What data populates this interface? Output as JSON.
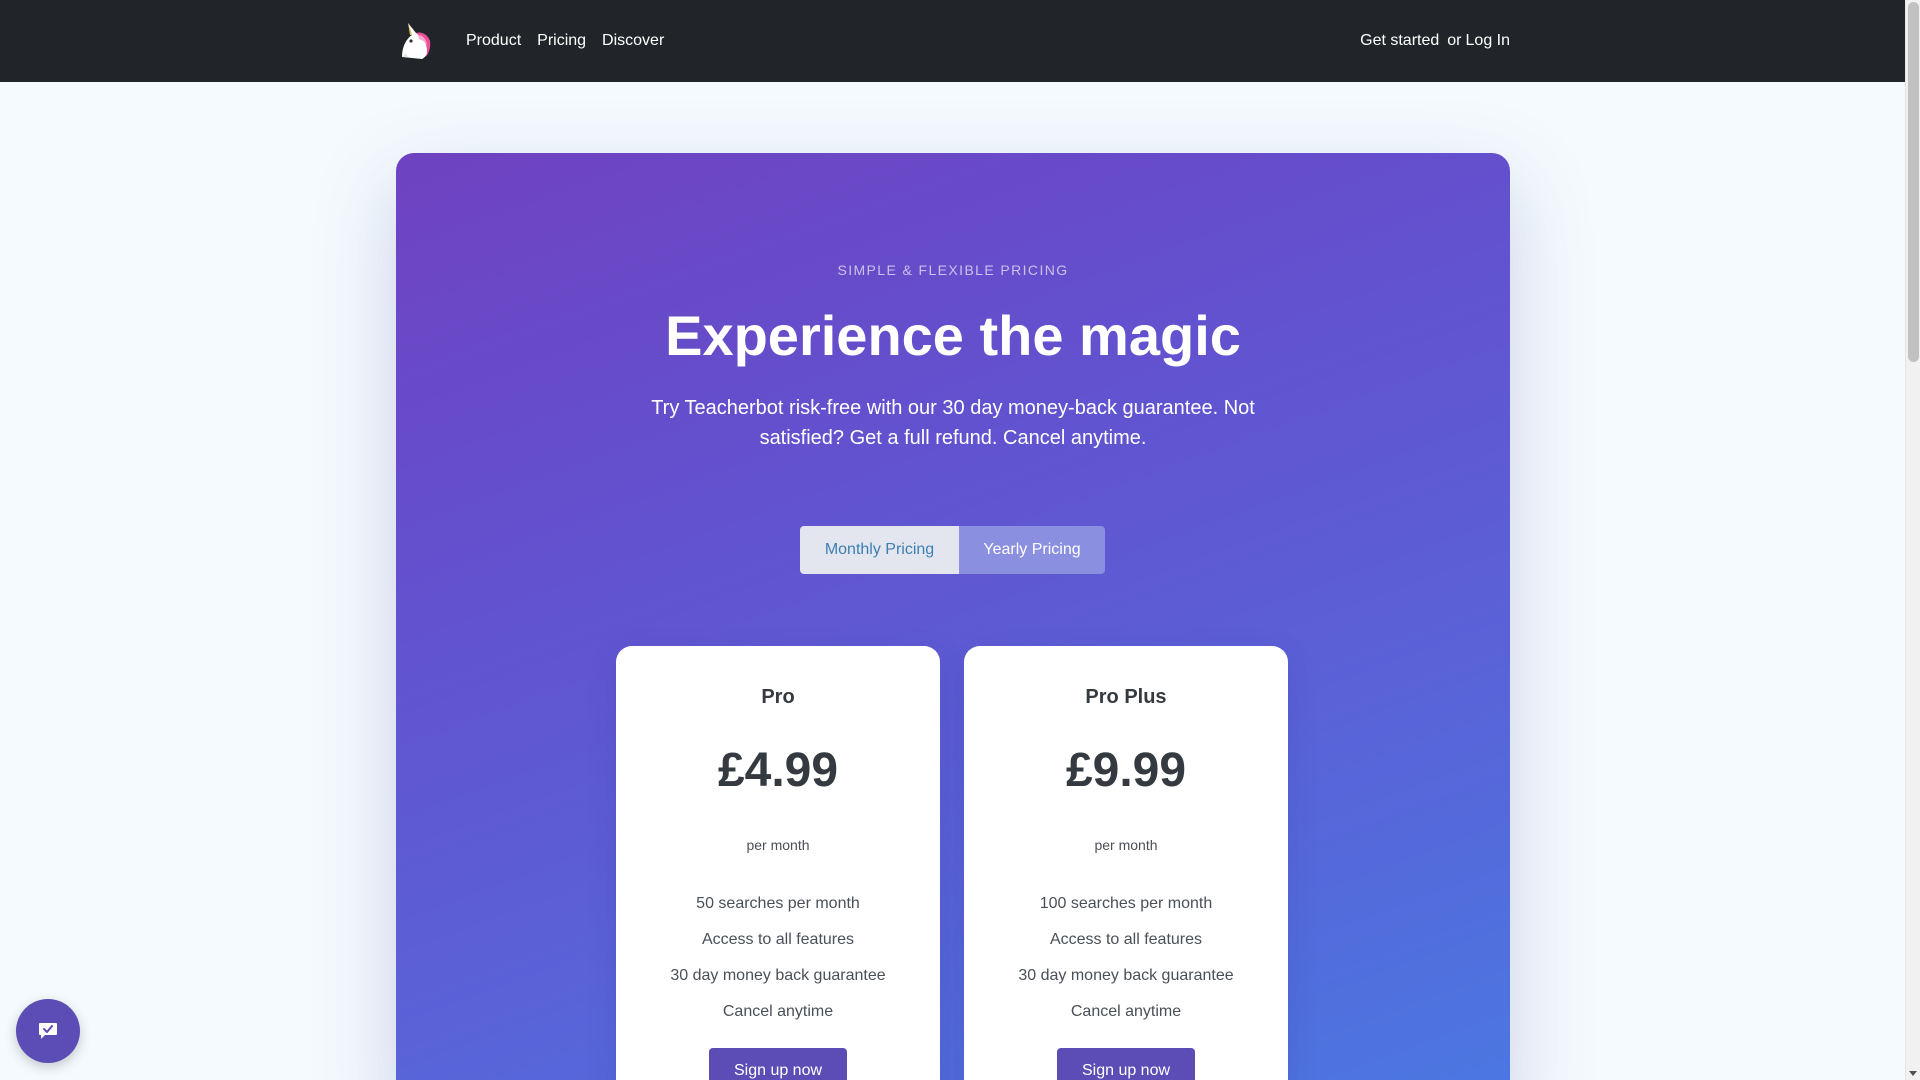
{
  "nav": {
    "logo_icon": "unicorn-icon",
    "links": [
      "Product",
      "Pricing",
      "Discover"
    ],
    "get_started": "Get started",
    "or_text": "or",
    "login": "Log In"
  },
  "hero": {
    "eyebrow": "SIMPLE & FLEXIBLE PRICING",
    "headline": "Experience the magic",
    "lead": "Try Teacherbot risk-free with our 30 day money-back guarantee. Not satisfied? Get a full refund. Cancel anytime."
  },
  "toggle": {
    "monthly": "Monthly Pricing",
    "yearly": "Yearly Pricing"
  },
  "plans": [
    {
      "name": "Pro",
      "price": "£4.99",
      "period": "per month",
      "features": [
        "50 searches per month",
        "Access to all features",
        "30 day money back guarantee",
        "Cancel anytime"
      ],
      "cta": "Sign up now"
    },
    {
      "name": "Pro Plus",
      "price": "£9.99",
      "period": "per month",
      "features": [
        "100 searches per month",
        "Access to all features",
        "30 day money back guarantee",
        "Cancel anytime"
      ],
      "cta": "Sign up now"
    }
  ],
  "chat": {
    "icon": "chat-check-icon"
  },
  "colors": {
    "nav_bg": "#212529",
    "hero_gradient_start": "#6f42c1",
    "hero_gradient_end": "#4a78e2",
    "button": "#5b4db5"
  }
}
